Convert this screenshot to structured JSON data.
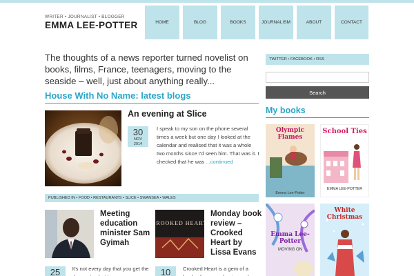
{
  "header": {
    "tagline": "WRITER • JOURNALIST • BLOGGER",
    "site_name": "EMMA LEE-POTTER"
  },
  "nav": {
    "items": [
      "HOME",
      "BLOG",
      "BOOKS",
      "JOURNALISM",
      "ABOUT",
      "CONTACT"
    ]
  },
  "intro": "The thoughts of a news reporter turned novelist on books, films, France, teenagers, moving to the seaside – well, just about anything really...",
  "blog_section_title": "House With No Name: latest blogs",
  "featured_post": {
    "title": "An evening at Slice",
    "day": "30",
    "month": "NOV",
    "year": "2014",
    "excerpt": "I speak to my son on the phone several times a week but one day I looked at the calendar and realised that it was a whole two months since I'd seen him. That was it. I checked that he was",
    "more_link": "...continued",
    "published_in": "PUBLISHED IN • FOOD • RESTAURANTS • SLICE • SWANSEA • WALES"
  },
  "post_two": {
    "title": "Meeting education minister Sam Gyimah",
    "day": "25",
    "excerpt": "It's not every day that you get the chance to chat to a"
  },
  "post_three": {
    "title": "Monday book review – Crooked Heart by Lissa Evans",
    "day": "10",
    "excerpt": "Crooked Heart is a gem of a book – funny, endearing and",
    "cover_text": "CROOKED HEART"
  },
  "sidebar": {
    "social_links": "TWITTER • FACEBOOK • RSS",
    "search_placeholder": "",
    "search_button": "Search",
    "books_title": "My books",
    "books": [
      {
        "title": "Olympic Flames",
        "author": "Emma Lee-Potter"
      },
      {
        "title": "School Ties",
        "author": "EMMA LEE-POTTER"
      },
      {
        "title": "Emma Lee-Potter",
        "subtitle": "MOVING ON"
      },
      {
        "title": "White Christmas",
        "author": ""
      }
    ]
  },
  "colors": {
    "accent": "#2aa7c9",
    "nav_bg": "#bfe3ea",
    "search_button_bg": "#555555"
  }
}
